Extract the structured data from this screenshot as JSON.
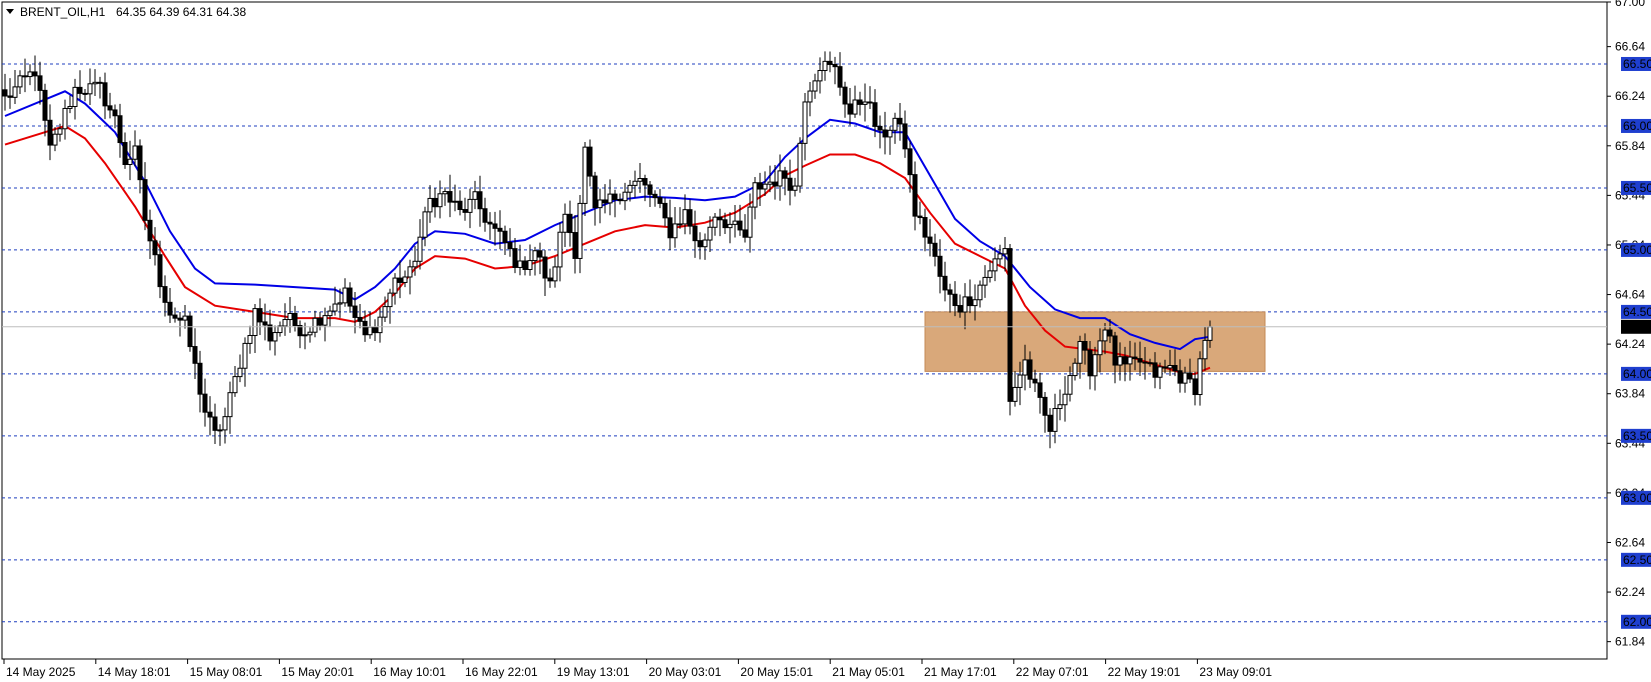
{
  "header": {
    "symbol": "BRENT_OIL,H1",
    "ohlc": "64.35 64.39 64.31 64.38"
  },
  "colors": {
    "grid": "#1f3fbf",
    "ma_fast": "#0000e6",
    "ma_slow": "#e60000",
    "zone": "#d9a87a",
    "zone_border": "#c48a56",
    "level_label_bg": "#1f3fcf",
    "current_label_bg": "#000000",
    "candle": "#000000"
  },
  "chart_data": {
    "type": "candlestick",
    "ylim": [
      61.7,
      67.0
    ],
    "y_ticks_plain": [
      "67.00",
      "66.64",
      "66.24",
      "65.84",
      "65.44",
      "65.04",
      "64.64",
      "64.24",
      "63.84",
      "63.44",
      "63.04",
      "62.64",
      "62.24",
      "61.84"
    ],
    "levels": [
      "66.50",
      "66.00",
      "65.50",
      "65.00",
      "64.50",
      "64.00",
      "63.50",
      "63.00",
      "62.50",
      "62.00"
    ],
    "current_price": "64.38",
    "x_labels": [
      "14 May 2025",
      "14 May 18:01",
      "15 May 08:01",
      "15 May 20:01",
      "16 May 10:01",
      "16 May 22:01",
      "19 May 13:01",
      "20 May 03:01",
      "20 May 15:01",
      "21 May 05:01",
      "21 May 17:01",
      "22 May 07:01",
      "22 May 19:01",
      "23 May 09:01"
    ],
    "zone": {
      "from_index": 184,
      "to_index": 252,
      "low": 64.02,
      "high": 64.5
    },
    "anchors": [
      [
        0,
        66.22
      ],
      [
        6,
        66.45
      ],
      [
        9,
        65.8
      ],
      [
        14,
        66.3
      ],
      [
        19,
        66.3
      ],
      [
        22,
        66.05
      ],
      [
        24,
        65.72
      ],
      [
        26,
        65.78
      ],
      [
        28,
        65.25
      ],
      [
        31,
        64.75
      ],
      [
        33,
        64.5
      ],
      [
        36,
        64.4
      ],
      [
        38,
        64.05
      ],
      [
        40,
        63.7
      ],
      [
        42,
        63.5
      ],
      [
        44,
        63.65
      ],
      [
        47,
        64.1
      ],
      [
        50,
        64.5
      ],
      [
        53,
        64.3
      ],
      [
        56,
        64.45
      ],
      [
        60,
        64.35
      ],
      [
        64,
        64.5
      ],
      [
        68,
        64.65
      ],
      [
        70,
        64.45
      ],
      [
        72,
        64.3
      ],
      [
        75,
        64.45
      ],
      [
        78,
        64.75
      ],
      [
        81,
        64.8
      ],
      [
        85,
        65.4
      ],
      [
        88,
        65.45
      ],
      [
        91,
        65.3
      ],
      [
        94,
        65.4
      ],
      [
        97,
        65.2
      ],
      [
        100,
        65.05
      ],
      [
        103,
        64.85
      ],
      [
        106,
        65.0
      ],
      [
        109,
        64.7
      ],
      [
        112,
        65.3
      ],
      [
        114,
        65.0
      ],
      [
        116,
        65.8
      ],
      [
        118,
        65.3
      ],
      [
        121,
        65.4
      ],
      [
        124,
        65.5
      ],
      [
        127,
        65.55
      ],
      [
        130,
        65.4
      ],
      [
        133,
        65.15
      ],
      [
        136,
        65.3
      ],
      [
        139,
        65.0
      ],
      [
        142,
        65.3
      ],
      [
        145,
        65.2
      ],
      [
        148,
        65.1
      ],
      [
        150,
        65.5
      ],
      [
        153,
        65.55
      ],
      [
        156,
        65.6
      ],
      [
        158,
        65.5
      ],
      [
        160,
        66.25
      ],
      [
        163,
        66.5
      ],
      [
        166,
        66.45
      ],
      [
        169,
        66.1
      ],
      [
        172,
        66.25
      ],
      [
        175,
        65.9
      ],
      [
        178,
        66.05
      ],
      [
        180,
        65.85
      ],
      [
        182,
        65.3
      ],
      [
        185,
        65.05
      ],
      [
        188,
        64.65
      ],
      [
        191,
        64.55
      ],
      [
        194,
        64.65
      ],
      [
        197,
        64.85
      ],
      [
        200,
        65.0
      ],
      [
        201,
        63.8
      ],
      [
        204,
        64.1
      ],
      [
        207,
        63.75
      ],
      [
        209,
        63.55
      ],
      [
        212,
        63.9
      ],
      [
        215,
        64.2
      ],
      [
        217,
        64.05
      ],
      [
        220,
        64.4
      ],
      [
        222,
        64.1
      ],
      [
        224,
        64.05
      ],
      [
        227,
        64.1
      ],
      [
        230,
        64.0
      ],
      [
        233,
        64.05
      ],
      [
        236,
        63.95
      ],
      [
        238,
        63.9
      ],
      [
        240,
        64.3
      ],
      [
        241,
        64.38
      ]
    ],
    "ema_fast": [
      [
        0,
        66.08
      ],
      [
        12,
        66.28
      ],
      [
        16,
        66.18
      ],
      [
        22,
        65.95
      ],
      [
        28,
        65.55
      ],
      [
        33,
        65.15
      ],
      [
        38,
        64.85
      ],
      [
        42,
        64.73
      ],
      [
        50,
        64.72
      ],
      [
        58,
        64.7
      ],
      [
        66,
        64.68
      ],
      [
        70,
        64.6
      ],
      [
        74,
        64.7
      ],
      [
        78,
        64.85
      ],
      [
        82,
        65.05
      ],
      [
        86,
        65.15
      ],
      [
        92,
        65.13
      ],
      [
        98,
        65.05
      ],
      [
        104,
        65.08
      ],
      [
        110,
        65.2
      ],
      [
        116,
        65.3
      ],
      [
        122,
        65.4
      ],
      [
        128,
        65.43
      ],
      [
        134,
        65.42
      ],
      [
        140,
        65.4
      ],
      [
        146,
        65.43
      ],
      [
        152,
        65.55
      ],
      [
        156,
        65.75
      ],
      [
        160,
        65.9
      ],
      [
        165,
        66.05
      ],
      [
        170,
        66.02
      ],
      [
        175,
        65.95
      ],
      [
        180,
        65.95
      ],
      [
        185,
        65.6
      ],
      [
        190,
        65.25
      ],
      [
        195,
        65.07
      ],
      [
        200,
        64.95
      ],
      [
        205,
        64.7
      ],
      [
        210,
        64.52
      ],
      [
        215,
        64.45
      ],
      [
        220,
        64.45
      ],
      [
        225,
        64.32
      ],
      [
        230,
        64.25
      ],
      [
        235,
        64.2
      ],
      [
        238,
        64.28
      ],
      [
        241,
        64.3
      ]
    ],
    "ema_slow": [
      [
        0,
        65.85
      ],
      [
        8,
        65.95
      ],
      [
        12,
        66.0
      ],
      [
        16,
        65.9
      ],
      [
        20,
        65.7
      ],
      [
        26,
        65.35
      ],
      [
        32,
        64.95
      ],
      [
        36,
        64.7
      ],
      [
        42,
        64.55
      ],
      [
        50,
        64.5
      ],
      [
        58,
        64.45
      ],
      [
        66,
        64.45
      ],
      [
        70,
        64.42
      ],
      [
        74,
        64.5
      ],
      [
        78,
        64.65
      ],
      [
        82,
        64.85
      ],
      [
        86,
        64.95
      ],
      [
        92,
        64.93
      ],
      [
        98,
        64.85
      ],
      [
        104,
        64.87
      ],
      [
        110,
        64.95
      ],
      [
        116,
        65.05
      ],
      [
        122,
        65.15
      ],
      [
        128,
        65.2
      ],
      [
        134,
        65.18
      ],
      [
        140,
        65.22
      ],
      [
        146,
        65.3
      ],
      [
        152,
        65.45
      ],
      [
        156,
        65.6
      ],
      [
        160,
        65.68
      ],
      [
        165,
        65.77
      ],
      [
        170,
        65.77
      ],
      [
        175,
        65.7
      ],
      [
        180,
        65.58
      ],
      [
        185,
        65.3
      ],
      [
        190,
        65.05
      ],
      [
        195,
        64.95
      ],
      [
        200,
        64.85
      ],
      [
        204,
        64.55
      ],
      [
        208,
        64.35
      ],
      [
        212,
        64.22
      ],
      [
        216,
        64.2
      ],
      [
        220,
        64.18
      ],
      [
        224,
        64.15
      ],
      [
        228,
        64.1
      ],
      [
        232,
        64.05
      ],
      [
        236,
        64.0
      ],
      [
        238,
        64.0
      ],
      [
        241,
        64.05
      ]
    ]
  }
}
